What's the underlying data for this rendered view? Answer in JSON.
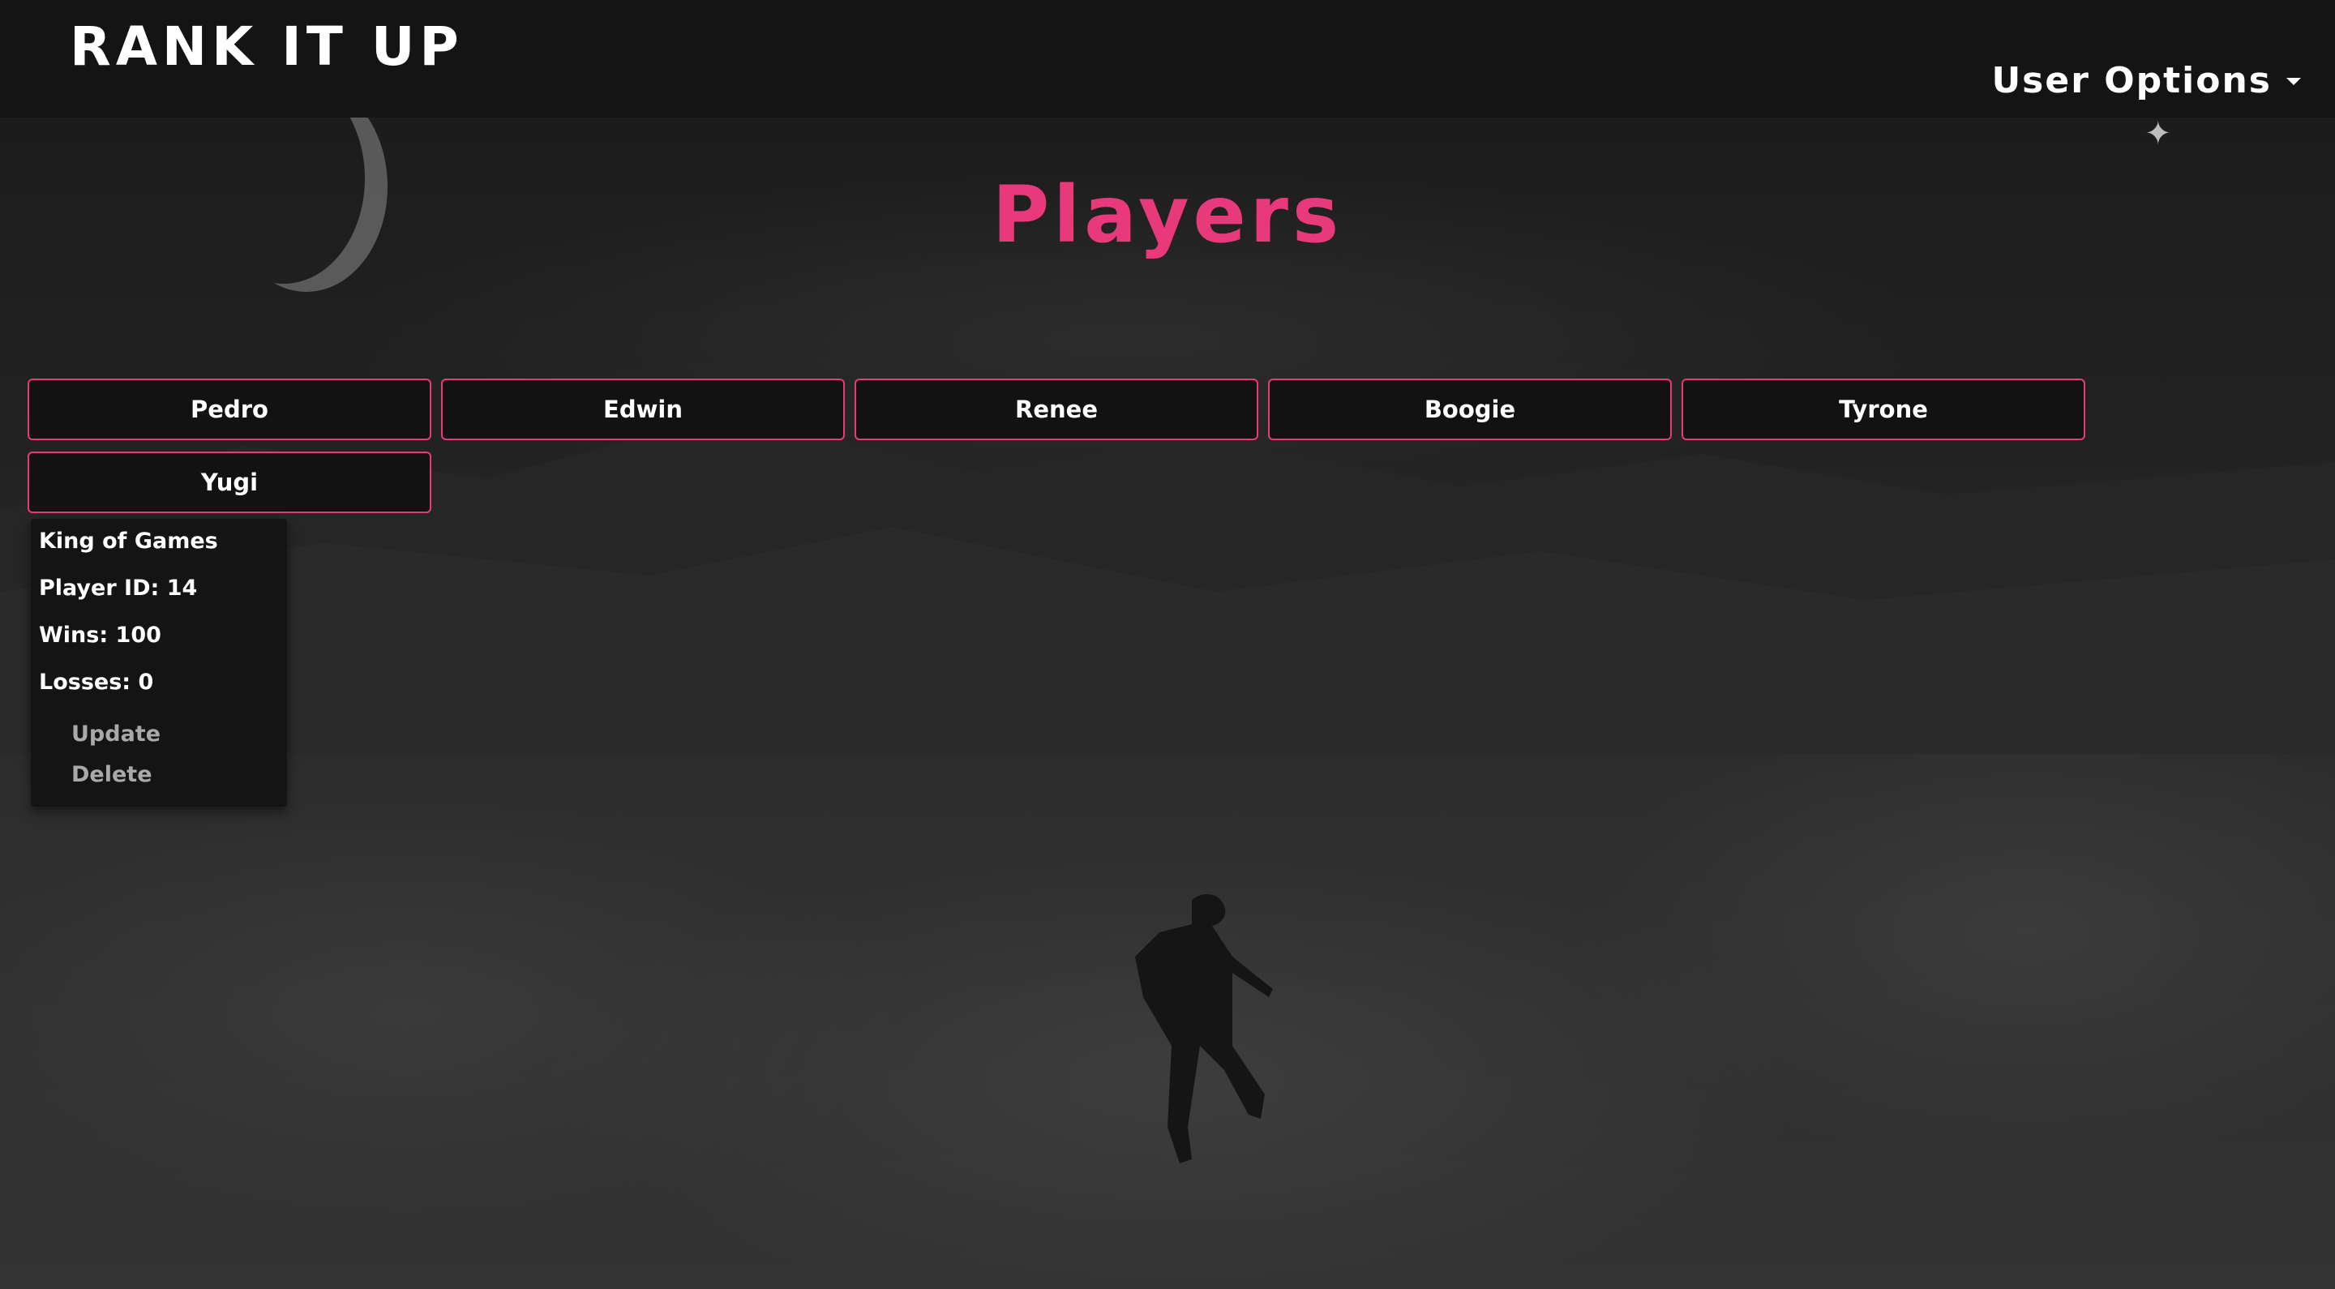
{
  "navbar": {
    "brand": "RANK IT UP",
    "user_options": "User Options"
  },
  "page": {
    "title": "Players"
  },
  "players": [
    {
      "name": "Pedro"
    },
    {
      "name": "Edwin"
    },
    {
      "name": "Renee"
    },
    {
      "name": "Boogie"
    },
    {
      "name": "Tyrone"
    },
    {
      "name": "Yugi"
    }
  ],
  "selected_player": {
    "title": "King of Games",
    "player_id": "Player ID: 14",
    "wins": "Wins: 100",
    "losses": "Losses: 0",
    "update_label": "Update",
    "delete_label": "Delete"
  },
  "colors": {
    "accent": "#e83a7a",
    "navbar": "#141414",
    "text": "#ffffff"
  }
}
